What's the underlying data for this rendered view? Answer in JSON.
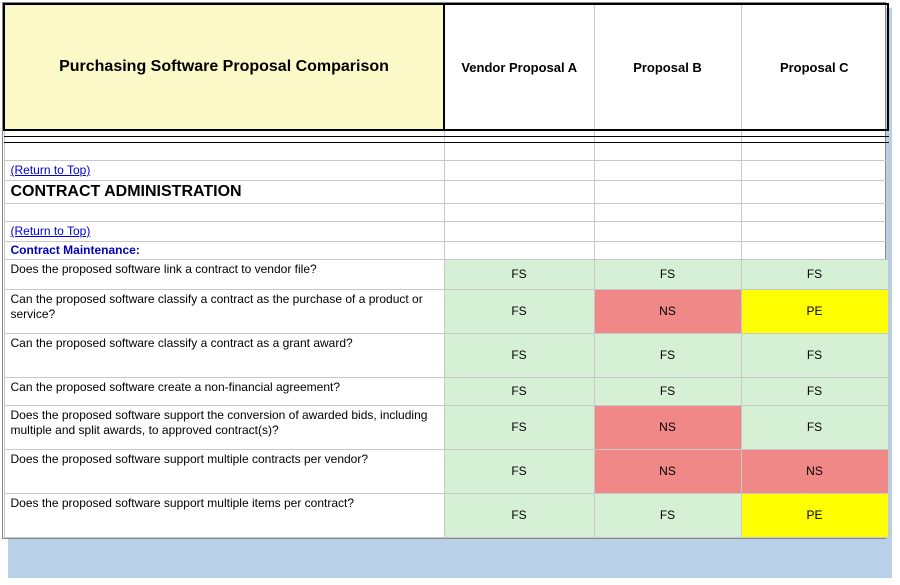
{
  "title": "Purchasing   Software Proposal Comparison",
  "vendors": [
    "Vendor Proposal A",
    "Proposal B",
    "Proposal C"
  ],
  "return_link": "(Return to Top)",
  "section": "CONTRACT ADMINISTRATION",
  "subsection": "Contract Maintenance:",
  "codes": {
    "fs": "FS",
    "ns": "NS",
    "pe": "PE"
  },
  "rows": [
    {
      "q": "Does the proposed software link a contract to vendor file?",
      "a": [
        "fs",
        "fs",
        "fs"
      ]
    },
    {
      "q": "Can the proposed software classify a contract as the purchase of a product or service?",
      "a": [
        "fs",
        "ns",
        "pe"
      ]
    },
    {
      "q": "Can the proposed software classify a contract as a grant award?",
      "a": [
        "fs",
        "fs",
        "fs"
      ]
    },
    {
      "q": "Can the proposed software create a non-financial agreement?",
      "a": [
        "fs",
        "fs",
        "fs"
      ]
    },
    {
      "q": "Does the proposed software support the conversion of awarded bids, including multiple and split awards, to approved contract(s)?",
      "a": [
        "fs",
        "ns",
        "fs"
      ]
    },
    {
      "q": "Does the proposed software support multiple contracts per vendor?",
      "a": [
        "fs",
        "ns",
        "ns"
      ]
    },
    {
      "q": "Does the proposed software support multiple items per contract?",
      "a": [
        "fs",
        "fs",
        "pe"
      ]
    }
  ]
}
